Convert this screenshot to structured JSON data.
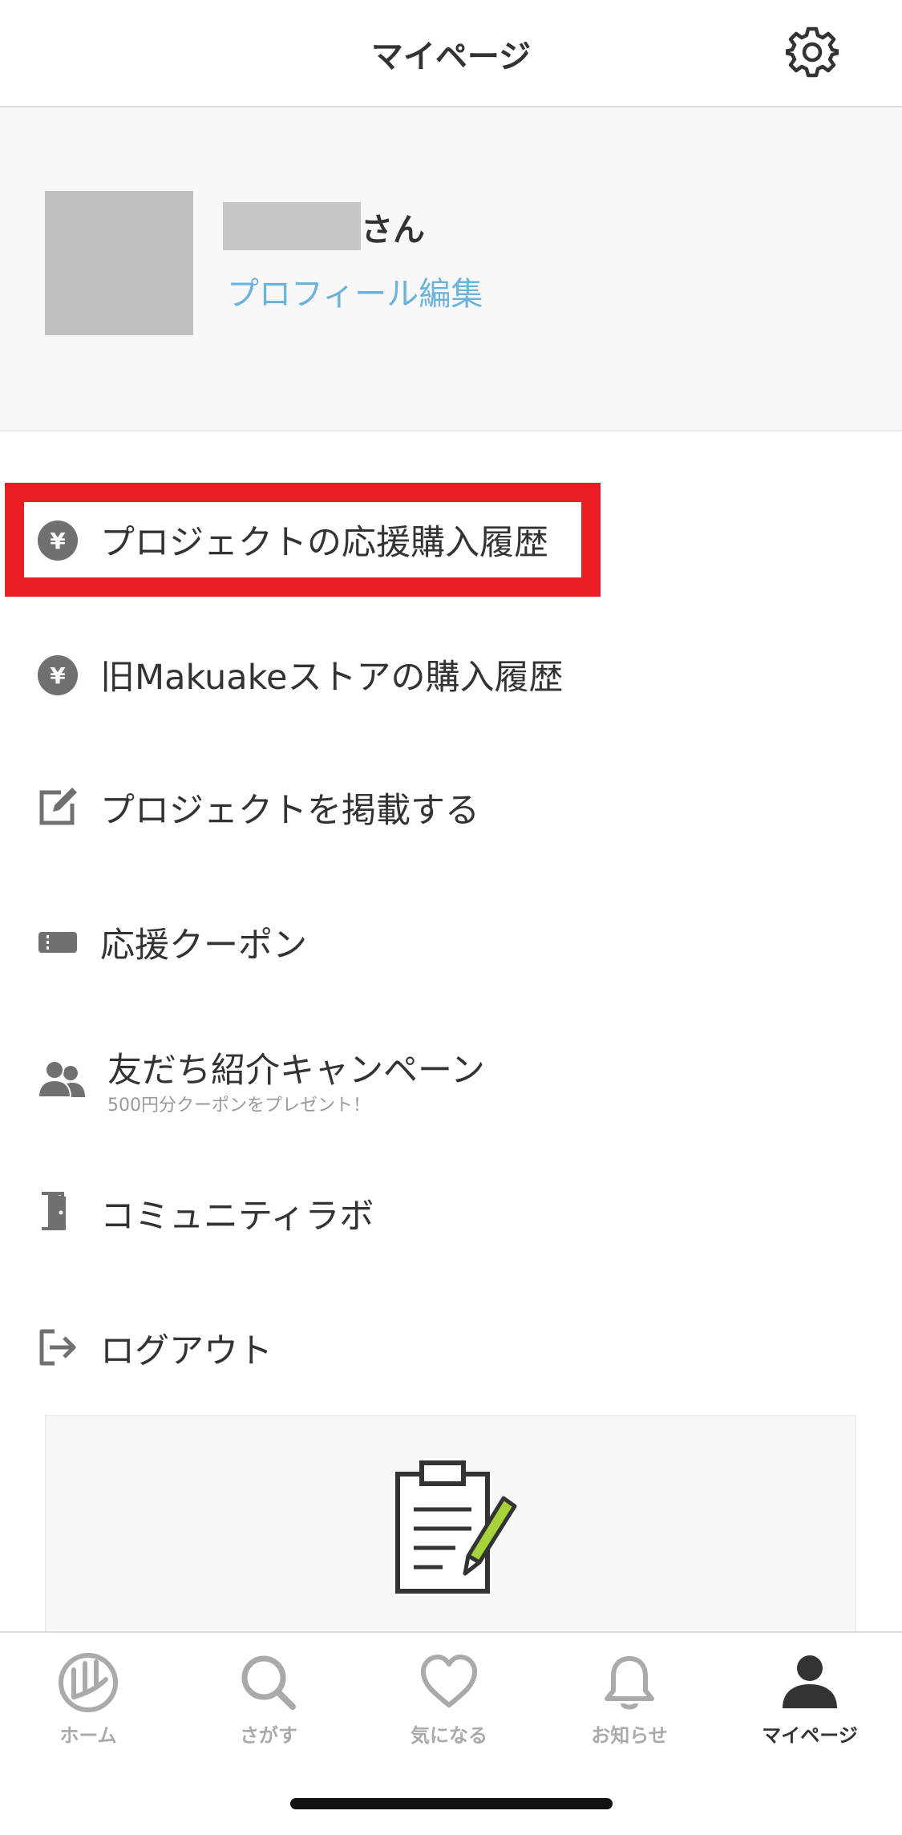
{
  "header": {
    "title": "マイページ"
  },
  "profile": {
    "name_suffix": "さん",
    "edit_link": "プロフィール編集"
  },
  "menu": {
    "items": [
      {
        "label": "プロジェクトの応援購入履歴",
        "icon": "yen-coin-icon"
      },
      {
        "label": "旧Makuakeストアの購入履歴",
        "icon": "yen-coin-icon"
      },
      {
        "label": "プロジェクトを掲載する",
        "icon": "edit-icon"
      },
      {
        "label": "応援クーポン",
        "icon": "ticket-icon"
      },
      {
        "label": "友だち紹介キャンペーン",
        "sub": "500円分クーポンをプレゼント！",
        "icon": "users-icon"
      },
      {
        "label": "コミュニティラボ",
        "icon": "door-icon"
      },
      {
        "label": "ログアウト",
        "icon": "logout-icon"
      }
    ]
  },
  "highlight_color": "#ea1c24",
  "tabs": [
    {
      "label": "ホーム",
      "icon": "home-icon",
      "active": false
    },
    {
      "label": "さがす",
      "icon": "search-icon",
      "active": false
    },
    {
      "label": "気になる",
      "icon": "heart-icon",
      "active": false
    },
    {
      "label": "お知らせ",
      "icon": "bell-icon",
      "active": false
    },
    {
      "label": "マイページ",
      "icon": "person-icon",
      "active": true
    }
  ]
}
